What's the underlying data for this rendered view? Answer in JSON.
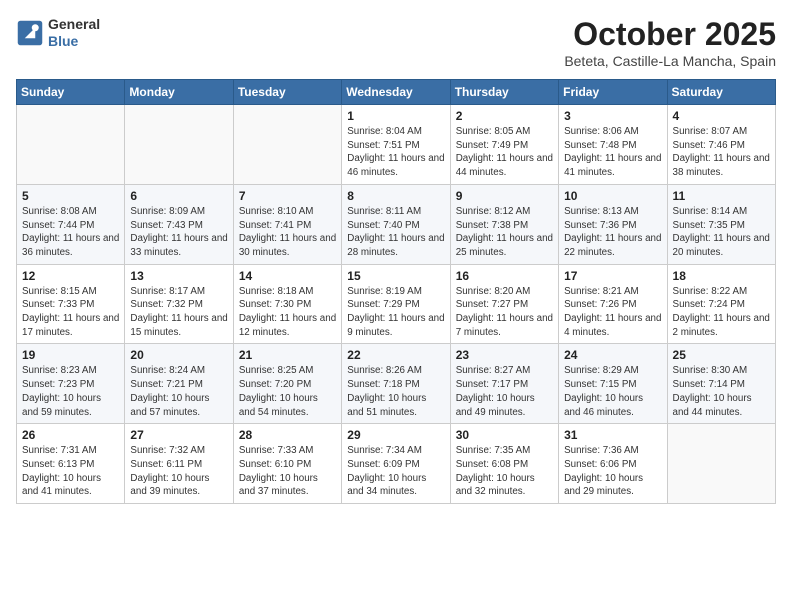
{
  "logo": {
    "line1": "General",
    "line2": "Blue"
  },
  "title": "October 2025",
  "subtitle": "Beteta, Castille-La Mancha, Spain",
  "days_of_week": [
    "Sunday",
    "Monday",
    "Tuesday",
    "Wednesday",
    "Thursday",
    "Friday",
    "Saturday"
  ],
  "weeks": [
    [
      {
        "day": "",
        "info": ""
      },
      {
        "day": "",
        "info": ""
      },
      {
        "day": "",
        "info": ""
      },
      {
        "day": "1",
        "info": "Sunrise: 8:04 AM\nSunset: 7:51 PM\nDaylight: 11 hours and 46 minutes."
      },
      {
        "day": "2",
        "info": "Sunrise: 8:05 AM\nSunset: 7:49 PM\nDaylight: 11 hours and 44 minutes."
      },
      {
        "day": "3",
        "info": "Sunrise: 8:06 AM\nSunset: 7:48 PM\nDaylight: 11 hours and 41 minutes."
      },
      {
        "day": "4",
        "info": "Sunrise: 8:07 AM\nSunset: 7:46 PM\nDaylight: 11 hours and 38 minutes."
      }
    ],
    [
      {
        "day": "5",
        "info": "Sunrise: 8:08 AM\nSunset: 7:44 PM\nDaylight: 11 hours and 36 minutes."
      },
      {
        "day": "6",
        "info": "Sunrise: 8:09 AM\nSunset: 7:43 PM\nDaylight: 11 hours and 33 minutes."
      },
      {
        "day": "7",
        "info": "Sunrise: 8:10 AM\nSunset: 7:41 PM\nDaylight: 11 hours and 30 minutes."
      },
      {
        "day": "8",
        "info": "Sunrise: 8:11 AM\nSunset: 7:40 PM\nDaylight: 11 hours and 28 minutes."
      },
      {
        "day": "9",
        "info": "Sunrise: 8:12 AM\nSunset: 7:38 PM\nDaylight: 11 hours and 25 minutes."
      },
      {
        "day": "10",
        "info": "Sunrise: 8:13 AM\nSunset: 7:36 PM\nDaylight: 11 hours and 22 minutes."
      },
      {
        "day": "11",
        "info": "Sunrise: 8:14 AM\nSunset: 7:35 PM\nDaylight: 11 hours and 20 minutes."
      }
    ],
    [
      {
        "day": "12",
        "info": "Sunrise: 8:15 AM\nSunset: 7:33 PM\nDaylight: 11 hours and 17 minutes."
      },
      {
        "day": "13",
        "info": "Sunrise: 8:17 AM\nSunset: 7:32 PM\nDaylight: 11 hours and 15 minutes."
      },
      {
        "day": "14",
        "info": "Sunrise: 8:18 AM\nSunset: 7:30 PM\nDaylight: 11 hours and 12 minutes."
      },
      {
        "day": "15",
        "info": "Sunrise: 8:19 AM\nSunset: 7:29 PM\nDaylight: 11 hours and 9 minutes."
      },
      {
        "day": "16",
        "info": "Sunrise: 8:20 AM\nSunset: 7:27 PM\nDaylight: 11 hours and 7 minutes."
      },
      {
        "day": "17",
        "info": "Sunrise: 8:21 AM\nSunset: 7:26 PM\nDaylight: 11 hours and 4 minutes."
      },
      {
        "day": "18",
        "info": "Sunrise: 8:22 AM\nSunset: 7:24 PM\nDaylight: 11 hours and 2 minutes."
      }
    ],
    [
      {
        "day": "19",
        "info": "Sunrise: 8:23 AM\nSunset: 7:23 PM\nDaylight: 10 hours and 59 minutes."
      },
      {
        "day": "20",
        "info": "Sunrise: 8:24 AM\nSunset: 7:21 PM\nDaylight: 10 hours and 57 minutes."
      },
      {
        "day": "21",
        "info": "Sunrise: 8:25 AM\nSunset: 7:20 PM\nDaylight: 10 hours and 54 minutes."
      },
      {
        "day": "22",
        "info": "Sunrise: 8:26 AM\nSunset: 7:18 PM\nDaylight: 10 hours and 51 minutes."
      },
      {
        "day": "23",
        "info": "Sunrise: 8:27 AM\nSunset: 7:17 PM\nDaylight: 10 hours and 49 minutes."
      },
      {
        "day": "24",
        "info": "Sunrise: 8:29 AM\nSunset: 7:15 PM\nDaylight: 10 hours and 46 minutes."
      },
      {
        "day": "25",
        "info": "Sunrise: 8:30 AM\nSunset: 7:14 PM\nDaylight: 10 hours and 44 minutes."
      }
    ],
    [
      {
        "day": "26",
        "info": "Sunrise: 7:31 AM\nSunset: 6:13 PM\nDaylight: 10 hours and 41 minutes."
      },
      {
        "day": "27",
        "info": "Sunrise: 7:32 AM\nSunset: 6:11 PM\nDaylight: 10 hours and 39 minutes."
      },
      {
        "day": "28",
        "info": "Sunrise: 7:33 AM\nSunset: 6:10 PM\nDaylight: 10 hours and 37 minutes."
      },
      {
        "day": "29",
        "info": "Sunrise: 7:34 AM\nSunset: 6:09 PM\nDaylight: 10 hours and 34 minutes."
      },
      {
        "day": "30",
        "info": "Sunrise: 7:35 AM\nSunset: 6:08 PM\nDaylight: 10 hours and 32 minutes."
      },
      {
        "day": "31",
        "info": "Sunrise: 7:36 AM\nSunset: 6:06 PM\nDaylight: 10 hours and 29 minutes."
      },
      {
        "day": "",
        "info": ""
      }
    ]
  ]
}
